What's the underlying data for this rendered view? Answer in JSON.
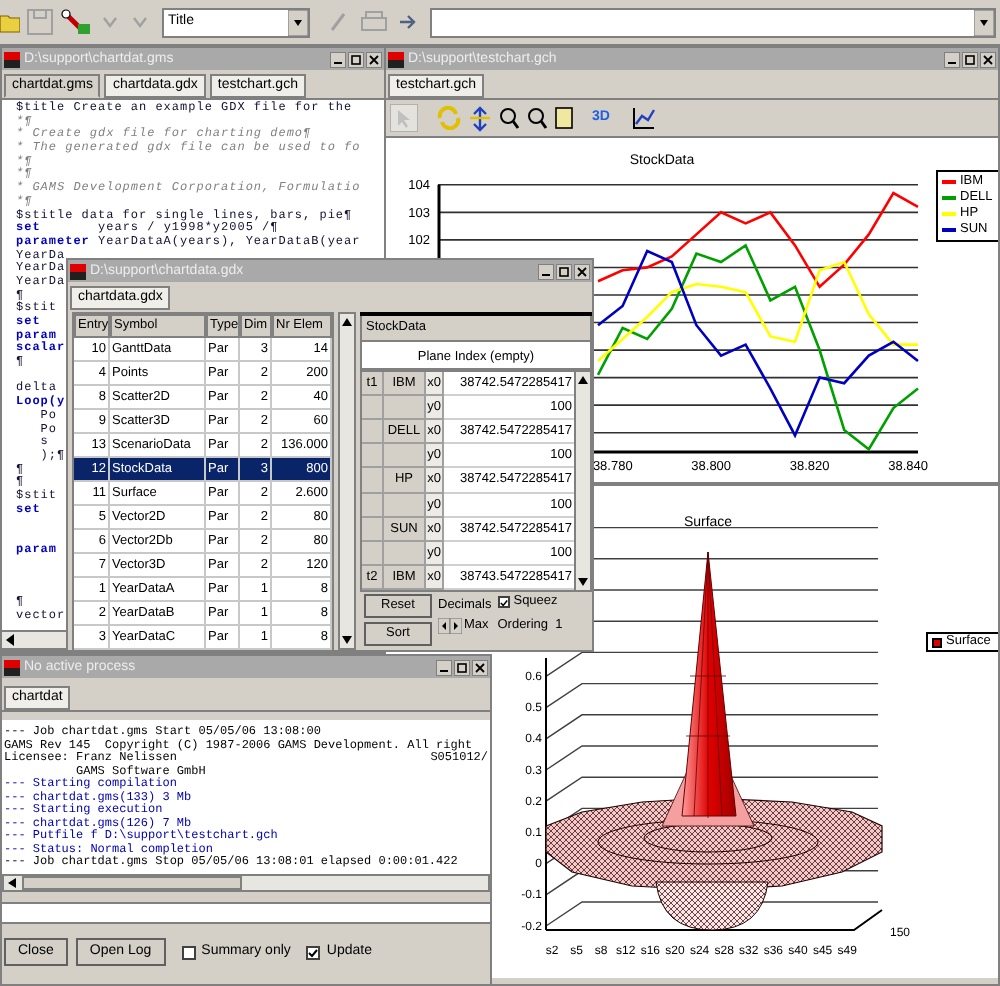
{
  "toolbar": {
    "style_select": "Title"
  },
  "editor": {
    "title": "D:\\support\\chartdat.gms",
    "tabs": [
      {
        "label": "chartdat.gms",
        "selected": true
      },
      {
        "label": "chartdata.gdx",
        "selected": false
      },
      {
        "label": "testchart.gch",
        "selected": false
      }
    ],
    "lines": [
      {
        "kind": "code",
        "text": "$title Create an example GDX file for the"
      },
      {
        "kind": "comment",
        "text": "*¶"
      },
      {
        "kind": "comment",
        "text": "* Create gdx file for charting demo¶"
      },
      {
        "kind": "comment",
        "text": "* The generated gdx file can be used to fo"
      },
      {
        "kind": "comment",
        "text": "*¶"
      },
      {
        "kind": "comment",
        "text": "*¶"
      },
      {
        "kind": "comment",
        "text": "* GAMS Development Corporation, Formulatio"
      },
      {
        "kind": "comment",
        "text": "*¶"
      },
      {
        "kind": "code",
        "text": "$stitle data for single lines, bars, pie¶"
      },
      {
        "kind": "code",
        "text": "**set**       years / y1998*y2005 /¶"
      },
      {
        "kind": "code",
        "text": "**parameter** YearDataA(years), YearDataB(year"
      },
      {
        "kind": "code",
        "text": "YearDa"
      },
      {
        "kind": "code",
        "text": "YearDa"
      },
      {
        "kind": "code",
        "text": "YearDa"
      },
      {
        "kind": "code",
        "text": "¶"
      },
      {
        "kind": "code",
        "text": "$stit"
      },
      {
        "kind": "keyword",
        "text": "set"
      },
      {
        "kind": "keyword",
        "text": "param"
      },
      {
        "kind": "keyword",
        "text": "scalar"
      },
      {
        "kind": "code",
        "text": "¶"
      },
      {
        "kind": "blank"
      },
      {
        "kind": "code",
        "text": "delta"
      },
      {
        "kind": "keyword",
        "text": "Loop(y"
      },
      {
        "kind": "code",
        "text": "   Po"
      },
      {
        "kind": "code",
        "text": "   Po"
      },
      {
        "kind": "code",
        "text": "   s"
      },
      {
        "kind": "code",
        "text": "   );¶"
      },
      {
        "kind": "code",
        "text": "¶"
      },
      {
        "kind": "code",
        "text": "¶"
      },
      {
        "kind": "code",
        "text": "$stit"
      },
      {
        "kind": "keyword",
        "text": "set"
      },
      {
        "kind": "blank"
      },
      {
        "kind": "blank"
      },
      {
        "kind": "keyword",
        "text": "param"
      },
      {
        "kind": "blank"
      },
      {
        "kind": "blank"
      },
      {
        "kind": "blank"
      },
      {
        "kind": "code",
        "text": "¶"
      },
      {
        "kind": "code",
        "text": "vector"
      }
    ]
  },
  "chart_window": {
    "title": "D:\\support\\testchart.gch",
    "tab": "testchart.gch",
    "toolbar_text": "3D",
    "line_chart": {
      "chart_data": {
        "type": "line",
        "title": "StockData",
        "x": [
          38.777,
          38.782,
          38.787,
          38.792,
          38.797,
          38.802,
          38.807,
          38.812,
          38.817,
          38.822,
          38.827,
          38.832,
          38.837,
          38.842
        ],
        "series": [
          {
            "name": "IBM",
            "color": "#ff0000",
            "values": [
              100.5,
              100.9,
              101.0,
              101.4,
              102.2,
              103.0,
              102.6,
              103.0,
              101.8,
              100.3,
              101.1,
              102.2,
              103.7,
              103.2
            ]
          },
          {
            "name": "DELL",
            "color": "#00a000",
            "values": [
              97.1,
              98.8,
              98.4,
              99.5,
              101.5,
              101.2,
              101.8,
              99.8,
              100.3,
              98.0,
              95.1,
              94.4,
              95.9,
              96.6
            ]
          },
          {
            "name": "HP",
            "color": "#ffff00",
            "values": [
              97.6,
              98.4,
              99.2,
              100.1,
              100.4,
              100.3,
              100.1,
              98.5,
              98.3,
              100.9,
              101.2,
              99.3,
              98.2,
              98.2
            ]
          },
          {
            "name": "SUN",
            "color": "#0000c0",
            "values": [
              98.9,
              99.6,
              101.6,
              101.2,
              98.9,
              97.8,
              98.2,
              96.6,
              94.9,
              97.0,
              96.8,
              97.8,
              98.3,
              97.6
            ]
          }
        ],
        "xlim": [
          38.7445,
          38.842
        ],
        "ylim": [
          94.3,
          104
        ],
        "xticks": [
          {
            "value": 38.78,
            "label": "38.780"
          },
          {
            "value": 38.8,
            "label": "38.800"
          },
          {
            "value": 38.82,
            "label": "38.820"
          },
          {
            "value": 38.84,
            "label": "38.840"
          }
        ],
        "yticks": [
          102,
          103,
          104
        ],
        "grid": true
      }
    },
    "surface": {
      "title": "Surface",
      "legend": "Surface",
      "y_labels": [
        "0.6",
        "0.5",
        "0.4",
        "0.3",
        "0.2",
        "0.1",
        "0",
        "-0.1",
        "-0.2"
      ],
      "x_labels": [
        "s2",
        "s5",
        "s8",
        "s12",
        "s16",
        "s20",
        "s24",
        "s28",
        "s32",
        "s36",
        "s40",
        "s45",
        "s49"
      ],
      "depth_label": "150"
    }
  },
  "gdx_window": {
    "title": "D:\\support\\chartdata.gdx",
    "tab": "chartdata.gdx",
    "columns": [
      "Entry",
      "Symbol",
      "Type",
      "Dim",
      "Nr Elem"
    ],
    "rows": [
      {
        "cells": [
          "10",
          "GanttData",
          "Par",
          "3",
          "14"
        ],
        "selected": false
      },
      {
        "cells": [
          "4",
          "Points",
          "Par",
          "2",
          "200"
        ],
        "selected": false
      },
      {
        "cells": [
          "8",
          "Scatter2D",
          "Par",
          "2",
          "40"
        ],
        "selected": false
      },
      {
        "cells": [
          "9",
          "Scatter3D",
          "Par",
          "2",
          "60"
        ],
        "selected": false
      },
      {
        "cells": [
          "13",
          "ScenarioData",
          "Par",
          "2",
          "136.000"
        ],
        "selected": false
      },
      {
        "cells": [
          "12",
          "StockData",
          "Par",
          "3",
          "800"
        ],
        "selected": true
      },
      {
        "cells": [
          "11",
          "Surface",
          "Par",
          "2",
          "2.600"
        ],
        "selected": false
      },
      {
        "cells": [
          "5",
          "Vector2D",
          "Par",
          "2",
          "80"
        ],
        "selected": false
      },
      {
        "cells": [
          "6",
          "Vector2Db",
          "Par",
          "2",
          "80"
        ],
        "selected": false
      },
      {
        "cells": [
          "7",
          "Vector3D",
          "Par",
          "2",
          "120"
        ],
        "selected": false
      },
      {
        "cells": [
          "1",
          "YearDataA",
          "Par",
          "1",
          "8"
        ],
        "selected": false
      },
      {
        "cells": [
          "2",
          "YearDataB",
          "Par",
          "1",
          "8"
        ],
        "selected": false
      },
      {
        "cells": [
          "3",
          "YearDataC",
          "Par",
          "1",
          "8"
        ],
        "selected": false
      }
    ],
    "detail": {
      "symbol": "StockData",
      "plane_index": "Plane Index (empty)",
      "rows": [
        {
          "t": "t1",
          "name": "IBM",
          "axis": "x0",
          "value": "38742.5472285417"
        },
        {
          "axis": "y0",
          "value": "100"
        },
        {
          "name": "DELL",
          "axis": "x0",
          "value": "38742.5472285417"
        },
        {
          "axis": "y0",
          "value": "100"
        },
        {
          "name": "HP",
          "axis": "x0",
          "value": "38742.5472285417"
        },
        {
          "axis": "y0",
          "value": "100"
        },
        {
          "name": "SUN",
          "axis": "x0",
          "value": "38742.5472285417"
        },
        {
          "axis": "y0",
          "value": "100"
        },
        {
          "t": "t2",
          "name": "IBM",
          "axis": "x0",
          "value": "38743.5472285417"
        }
      ],
      "buttons": [
        "Reset",
        "Sort"
      ],
      "decimals_label": "Decimals",
      "max_label": "Max",
      "squeeze": {
        "label": "Squeez",
        "checked": true
      },
      "ordering": "Ordering  1"
    }
  },
  "process_window": {
    "title": "No active process",
    "tab": "chartdat",
    "log": [
      {
        "kind": "plain",
        "text": "--- Job chartdat.gms Start 05/05/06 13:08:00"
      },
      {
        "kind": "plain",
        "text": "GAMS Rev 145  Copyright (C) 1987-2006 GAMS Development. All right"
      },
      {
        "kind": "plain",
        "text": "Licensee: Franz Nelissen",
        "right": "S051012/"
      },
      {
        "kind": "plain",
        "text": "          GAMS Software GmbH"
      },
      {
        "kind": "info",
        "text": "--- Starting compilation"
      },
      {
        "kind": "info",
        "text": "--- chartdat.gms(133) 3 Mb"
      },
      {
        "kind": "info",
        "text": "--- Starting execution"
      },
      {
        "kind": "info",
        "text": "--- chartdat.gms(126) 7 Mb"
      },
      {
        "kind": "info",
        "text": "--- Putfile f D:\\support\\testchart.gch"
      },
      {
        "kind": "info",
        "text": "--- Status: Normal completion"
      },
      {
        "kind": "plain",
        "text": "--- Job chartdat.gms Stop 05/05/06 13:08:01 elapsed 0:00:01.422"
      }
    ],
    "buttons": [
      "Close",
      "Open Log"
    ],
    "options": [
      {
        "label": "Summary only",
        "checked": false
      },
      {
        "label": "Update",
        "checked": true
      }
    ]
  }
}
